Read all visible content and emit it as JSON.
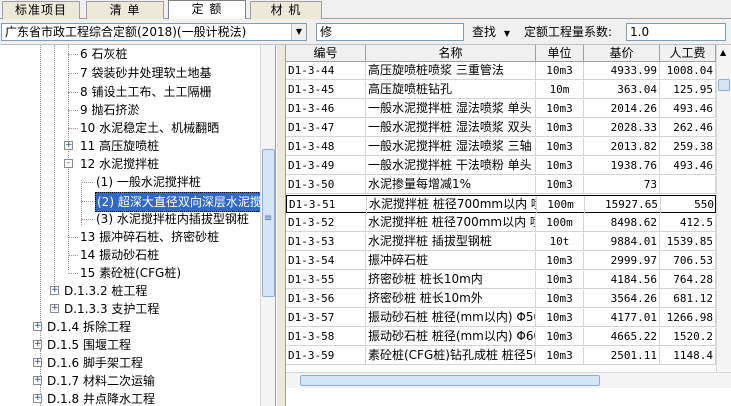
{
  "tabs": [
    "标准项目",
    "清 单",
    "定 额",
    "材 机"
  ],
  "toolbar": {
    "quota_lib": "广东省市政工程综合定额(2018)(一般计税法)",
    "search_text": "修",
    "find_label": "查找",
    "coef_label": "定额工程量系数:",
    "coef_value": "1.0"
  },
  "tree": [
    {
      "label": "6 石灰桩"
    },
    {
      "label": "7 袋装砂井处理软土地基"
    },
    {
      "label": "8 铺设土工布、土工隔栅"
    },
    {
      "label": "9 抛石挤淤"
    },
    {
      "label": "10 水泥稳定土、机械翻晒"
    },
    {
      "label": "11 高压旋喷桩",
      "expander": "+"
    },
    {
      "label": "12 水泥搅拌桩",
      "expander": "-"
    },
    {
      "label": "(1) 一般水泥搅拌桩"
    },
    {
      "label": "(2) 超深大直径双向深层水泥搅"
    },
    {
      "label": "(3) 水泥搅拌桩内插拔型钢桩"
    },
    {
      "label": "13 振冲碎石桩、挤密砂桩"
    },
    {
      "label": "14 振动砂石桩"
    },
    {
      "label": "15 素砼桩(CFG桩)"
    },
    {
      "label": "D.1.3.2 桩工程",
      "expander": "+"
    },
    {
      "label": "D.1.3.3 支护工程",
      "expander": "+"
    },
    {
      "label": "D.1.4 拆除工程",
      "expander": "+"
    },
    {
      "label": "D.1.5 围堰工程",
      "expander": "+"
    },
    {
      "label": "D.1.6 脚手架工程",
      "expander": "+"
    },
    {
      "label": "D.1.7 材料二次运输",
      "expander": "+"
    },
    {
      "label": "D.1.8 井点降水工程",
      "expander": "+"
    }
  ],
  "grid": {
    "headers": [
      "编号",
      "名称",
      "单位",
      "基价",
      "人工费"
    ],
    "rows": [
      {
        "code": "D1-3-44",
        "name": "高压旋喷桩喷浆 三重管法",
        "unit": "10m3",
        "price": "4933.99",
        "labor": "1008.04"
      },
      {
        "code": "D1-3-45",
        "name": "高压旋喷桩钻孔",
        "unit": "10m",
        "price": "363.04",
        "labor": "125.95"
      },
      {
        "code": "D1-3-46",
        "name": "一般水泥搅拌桩 湿法喷浆 单头",
        "unit": "10m3",
        "price": "2014.26",
        "labor": "493.46"
      },
      {
        "code": "D1-3-47",
        "name": "一般水泥搅拌桩 湿法喷浆 双头",
        "unit": "10m3",
        "price": "2028.33",
        "labor": "262.46"
      },
      {
        "code": "D1-3-48",
        "name": "一般水泥搅拌桩 湿法喷浆 三轴",
        "unit": "10m3",
        "price": "2013.82",
        "labor": "259.38"
      },
      {
        "code": "D1-3-49",
        "name": "一般水泥搅拌桩 干法喷粉 单头",
        "unit": "10m3",
        "price": "1938.76",
        "labor": "493.46"
      },
      {
        "code": "D1-3-50",
        "name": "水泥掺量每增减1%",
        "unit": "10m3",
        "price": "73",
        "labor": ""
      },
      {
        "code": "D1-3-51",
        "name": "水泥搅拌桩 桩径700mm以内 喷浆",
        "unit": "100m",
        "price": "15927.65",
        "labor": "550"
      },
      {
        "code": "D1-3-52",
        "name": "水泥搅拌桩 桩径700mm以内 喷浆",
        "unit": "100m",
        "price": "8498.62",
        "labor": "412.5"
      },
      {
        "code": "D1-3-53",
        "name": "水泥搅拌桩 插拔型钢桩",
        "unit": "10t",
        "price": "9884.01",
        "labor": "1539.85"
      },
      {
        "code": "D1-3-54",
        "name": "振冲碎石桩",
        "unit": "10m3",
        "price": "2999.97",
        "labor": "706.53"
      },
      {
        "code": "D1-3-55",
        "name": "挤密砂桩 桩长10m内",
        "unit": "10m3",
        "price": "4184.56",
        "labor": "764.28"
      },
      {
        "code": "D1-3-56",
        "name": "挤密砂桩 桩长10m外",
        "unit": "10m3",
        "price": "3564.26",
        "labor": "681.12"
      },
      {
        "code": "D1-3-57",
        "name": "振动砂石桩 桩径(mm以内) Φ500",
        "unit": "10m3",
        "price": "4177.01",
        "labor": "1266.98"
      },
      {
        "code": "D1-3-58",
        "name": "振动砂石桩 桩径(mm以内) Φ600",
        "unit": "10m3",
        "price": "4665.22",
        "labor": "1520.2"
      },
      {
        "code": "D1-3-59",
        "name": "素砼桩(CFG桩)钻孔成桩 桩径50",
        "unit": "10m3",
        "price": "2501.11",
        "labor": "1148.4"
      }
    ]
  },
  "icons": {
    "grip": "grip-icon",
    "arrow_up": "arrow-up-icon",
    "arrow_down": "arrow-down-icon"
  }
}
